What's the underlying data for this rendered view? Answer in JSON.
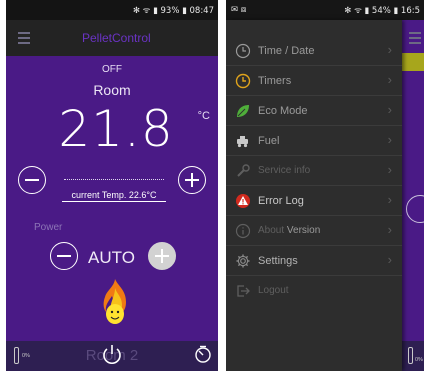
{
  "left": {
    "statusbar": {
      "right": "✻ ᯤ ▮ 93% ▮ 08:47"
    },
    "app_title": "PelletControl",
    "state": "OFF",
    "zone": "Room",
    "setpoint": "21.8",
    "unit": "°C",
    "current_temp": "current Temp. 22.6°C",
    "power_label": "Power",
    "mode": "AUTO",
    "bottom": {
      "fuel_pct": "0%",
      "room_ghost": "Room 2"
    },
    "colors": {
      "background": "#4a1a86",
      "appbar": "#232323",
      "bottombar": "#2e1f52"
    }
  },
  "right": {
    "statusbar": {
      "left": "✉ ⧈",
      "right": "✻ ᯤ ▮ 54% ▮ 16:5"
    },
    "background_fuel_pct": "0%",
    "menu": [
      {
        "label": "Time / Date",
        "icon": "clock-icon"
      },
      {
        "label": "Timers",
        "icon": "timer-icon"
      },
      {
        "label": "Eco Mode",
        "icon": "leaf-icon"
      },
      {
        "label": "Fuel",
        "icon": "fuel-icon"
      },
      {
        "label": "Service info",
        "icon": "wrench-icon"
      },
      {
        "label": "Error Log",
        "icon": "warning-icon"
      },
      {
        "label": "About",
        "label_strong": "Version",
        "icon": "info-icon"
      },
      {
        "label": "Settings",
        "icon": "gear-icon"
      },
      {
        "label": "Logout",
        "icon": "logout-icon"
      }
    ],
    "colors": {
      "drawer": "#2d2d2d",
      "timer_icon": "#e0a41c",
      "leaf_icon": "#4fae3a",
      "warning_icon": "#d22a1e"
    }
  }
}
